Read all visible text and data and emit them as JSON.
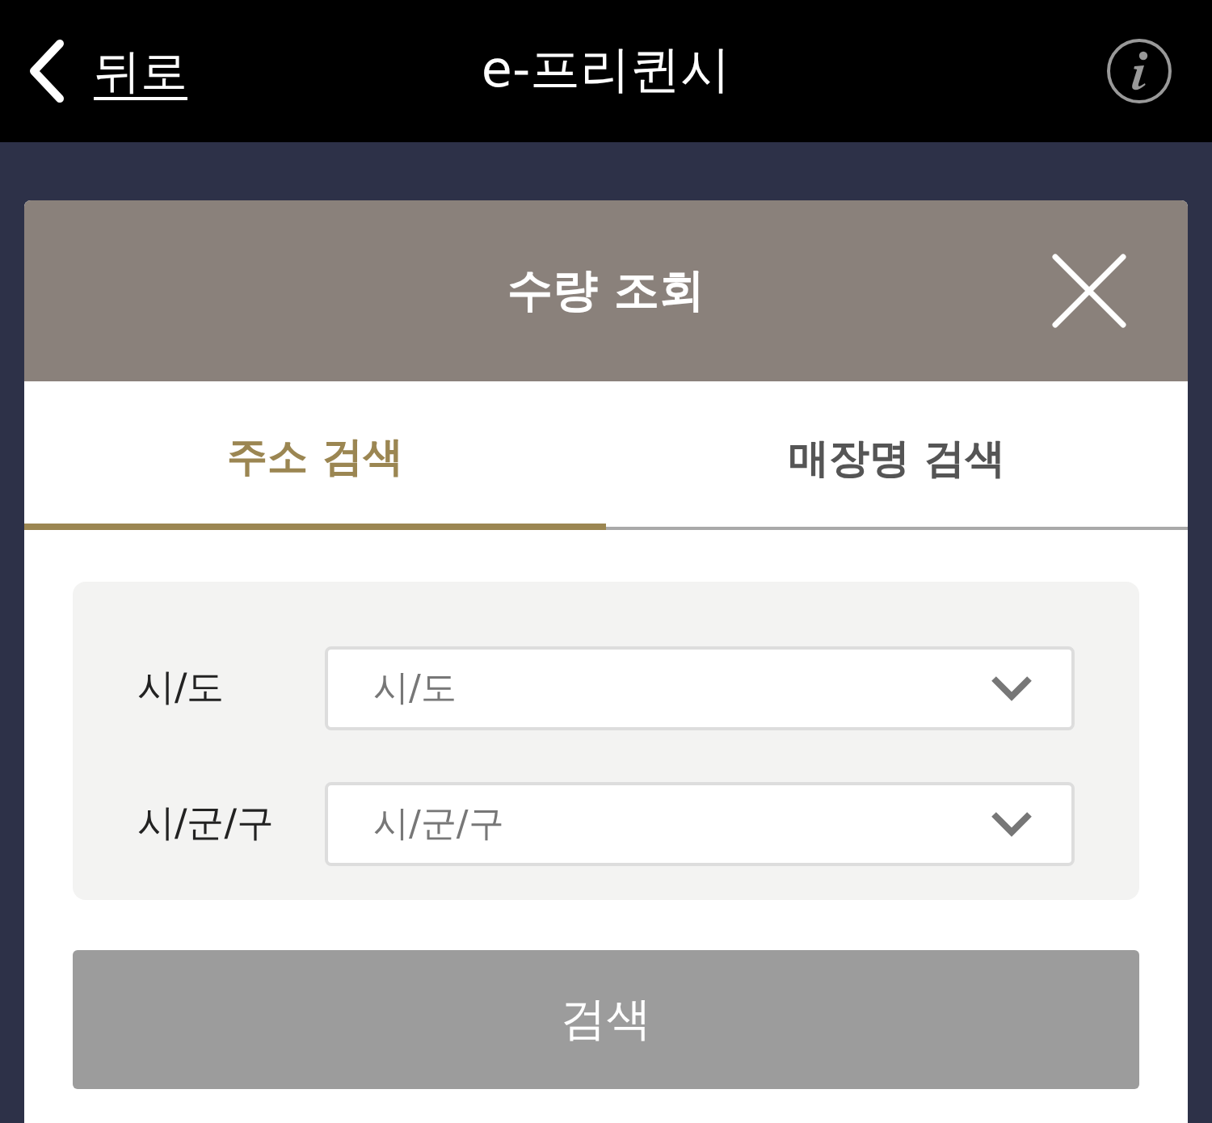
{
  "header": {
    "back_label": "뒤로",
    "title": "e-프리퀸시"
  },
  "modal": {
    "title": "수량 조회"
  },
  "tabs": [
    {
      "label": "주소 검색",
      "selected": true
    },
    {
      "label": "매장명 검색",
      "selected": false
    }
  ],
  "fields": [
    {
      "label": "시/도",
      "placeholder": "시/도"
    },
    {
      "label": "시/군/구",
      "placeholder": "시/군/구"
    }
  ],
  "search_button": "검색"
}
